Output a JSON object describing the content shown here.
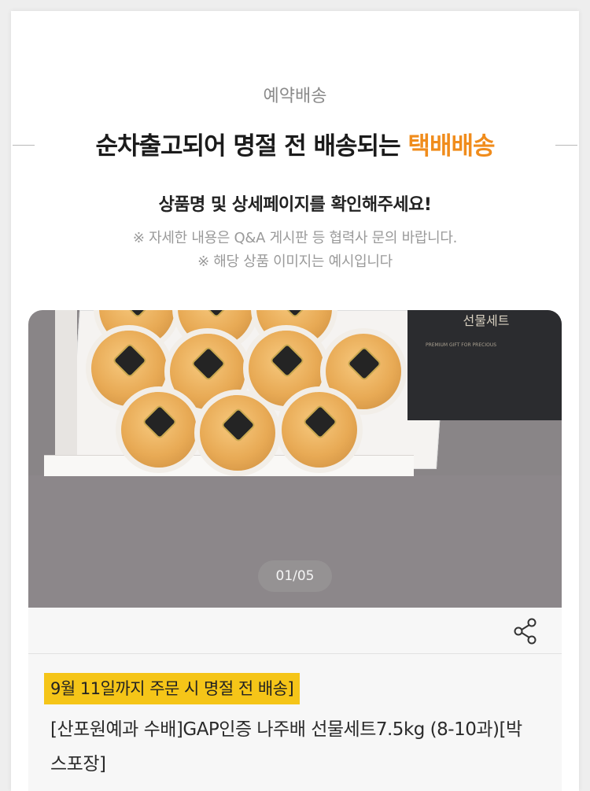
{
  "header": {
    "eyebrow": "예약배송",
    "headline_main": "순차출고되어 명절 전 배송되는",
    "headline_highlight": "택배배송",
    "subtitle": "상품명 및 상세페이지를 확인해주세요!",
    "note_line1": "※ 자세한 내용은 Q&A 게시판 등 협력사 문의 바랍니다.",
    "note_line2": "※ 해당 상품 이미지는 예시입니다"
  },
  "gallery": {
    "counter": "01/05",
    "giftbox_label": "선물세트",
    "giftbox_small_text": "PREMIUM GIFT FOR PRECIOUS",
    "current_index": 1,
    "total": 5
  },
  "product": {
    "badge": "9월 11일까지 주문 시 명절 전 배송]",
    "name": "[산포원예과 수배]GAP인증 나주배 선물세트7.5kg (8-10과)[박스포장]"
  },
  "icons": {
    "share": "share-icon"
  },
  "colors": {
    "accent_orange": "#f08c1c",
    "badge_yellow": "#f5c518"
  }
}
